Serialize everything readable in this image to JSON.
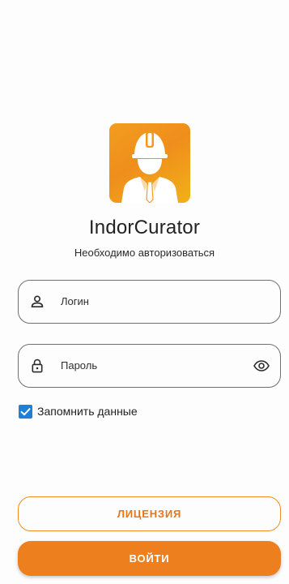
{
  "app": {
    "title": "IndorCurator",
    "subtitle": "Необходимо авторизоваться"
  },
  "logo": {
    "icon": "construction-worker-icon",
    "gradient": [
      "#f29d1e",
      "#f1b117"
    ]
  },
  "form": {
    "login": {
      "placeholder": "Логин",
      "value": "",
      "icon": "person-icon"
    },
    "password": {
      "placeholder": "Пароль",
      "value": "",
      "icon": "lock-icon",
      "toggle_icon": "eye-icon"
    },
    "remember": {
      "label": "Запомнить данные",
      "checked": true
    }
  },
  "buttons": {
    "license_label": "ЛИЦЕНЗИЯ",
    "login_label": "ВОЙТИ"
  },
  "colors": {
    "accent": "#ee7f1f",
    "checkbox": "#1e7fd6",
    "border": "#6f6f6f"
  }
}
